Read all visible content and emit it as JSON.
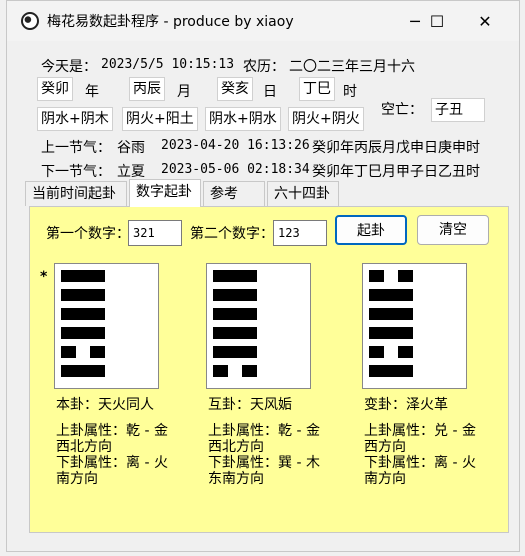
{
  "window": {
    "title": "梅花易数起卦程序 - produce by xiaoy",
    "minimize": "─",
    "maximize": "☐",
    "close": "✕"
  },
  "date": {
    "today_label": "今天是：",
    "today_value": "2023/5/5 10:15:13",
    "lunar_label": "农历：",
    "lunar_value": "二〇二三年三月十六"
  },
  "ganzhi": {
    "year_val": "癸卯",
    "year_unit": "年",
    "month_val": "丙辰",
    "month_unit": "月",
    "day_val": "癸亥",
    "day_unit": "日",
    "hour_val": "丁巳",
    "hour_unit": "时"
  },
  "nayin": [
    "阴水+阴木",
    "阴火+阳土",
    "阴水+阴水",
    "阴火+阴火"
  ],
  "kongwang": {
    "label": "空亡：",
    "value": "子丑"
  },
  "jieqi": {
    "prev_label": "上一节气：",
    "prev_name": "谷雨",
    "prev_time": "2023-04-20 16:13:26",
    "prev_gz": "癸卯年丙辰月戊申日庚申时",
    "next_label": "下一节气：",
    "next_name": "立夏",
    "next_time": "2023-05-06 02:18:34",
    "next_gz": "癸卯年丁巳月甲子日乙丑时"
  },
  "tabs": [
    "当前时间起卦",
    "数字起卦",
    "参考",
    "六十四卦"
  ],
  "form": {
    "num1_label": "第一个数字：",
    "num1_value": "321",
    "num2_label": "第二个数字：",
    "num2_value": "123",
    "qigua_button": "起卦",
    "clear_button": "清空"
  },
  "moving_marker": "*",
  "hexagrams": [
    {
      "lines_top_to_bottom": [
        "yang",
        "yang",
        "yang",
        "yang",
        "yin",
        "yang"
      ],
      "name_label": "本卦：",
      "name": "天火同人",
      "upper_label": "上卦属性：",
      "upper": "乾 - 金",
      "upper_dir": "西北方向",
      "lower_label": "下卦属性：",
      "lower": "离 - 火",
      "lower_dir": "南方向"
    },
    {
      "lines_top_to_bottom": [
        "yang",
        "yang",
        "yang",
        "yang",
        "yang",
        "yin"
      ],
      "name_label": "互卦：",
      "name": "天风姤",
      "upper_label": "上卦属性：",
      "upper": "乾 - 金",
      "upper_dir": "西北方向",
      "lower_label": "下卦属性：",
      "lower": "巽 - 木",
      "lower_dir": "东南方向"
    },
    {
      "lines_top_to_bottom": [
        "yin",
        "yang",
        "yang",
        "yang",
        "yin",
        "yang"
      ],
      "name_label": "变卦：",
      "name": "泽火革",
      "upper_label": "上卦属性：",
      "upper": "兑 - 金",
      "upper_dir": "西方向",
      "lower_label": "下卦属性：",
      "lower": "离 - 火",
      "lower_dir": "南方向"
    }
  ]
}
